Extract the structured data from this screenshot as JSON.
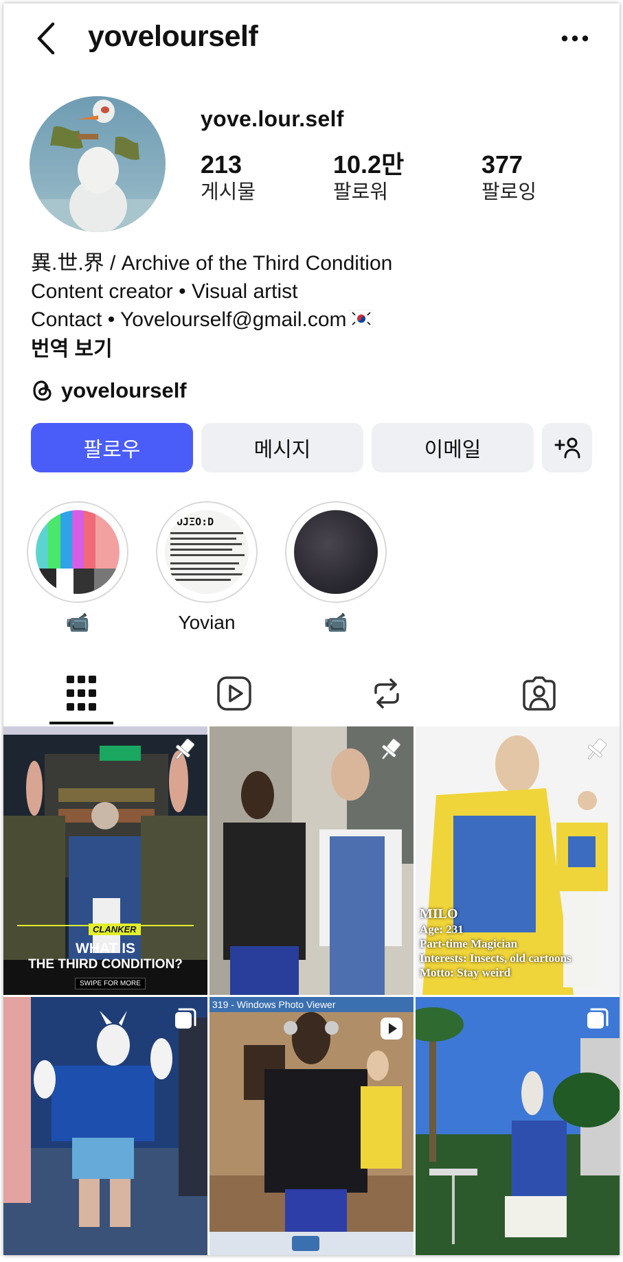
{
  "header": {
    "username": "yovelourself"
  },
  "profile": {
    "display_name": "yove.lour.self",
    "stats": [
      {
        "value": "213",
        "label": "게시물"
      },
      {
        "value": "10.2만",
        "label": "팔로워"
      },
      {
        "value": "377",
        "label": "팔로잉"
      }
    ],
    "bio": [
      "異.世.界 / Archive of the Third Condition",
      "Content creator • Visual artist",
      "Contact • Yovelourself@gmail.com"
    ],
    "translate_label": "번역 보기",
    "threads_handle": "yovelourself"
  },
  "actions": {
    "follow": "팔로우",
    "message": "메시지",
    "email": "이메일",
    "add_user": "+፩"
  },
  "highlights": [
    {
      "label": "📹",
      "icon": "video-camera-emoji"
    },
    {
      "label": "Yovian",
      "icon": ""
    },
    {
      "label": "📹",
      "icon": "video-camera-emoji"
    }
  ],
  "tabs": [
    "grid-icon",
    "reels-icon",
    "reposts-icon",
    "tagged-icon"
  ],
  "posts": [
    {
      "type": "pinned",
      "overlay": [
        "CLANKER",
        "WHAT IS",
        "THE THIRD CONDITION?",
        "SWIPE FOR MORE"
      ]
    },
    {
      "type": "pinned"
    },
    {
      "type": "pinned",
      "overlay": [
        "MILO",
        "Age: 231",
        "Part-time Magician",
        "Interests: Insects, old cartoons",
        "Motto: Stay weird"
      ]
    },
    {
      "type": "carousel"
    },
    {
      "type": "reel",
      "overlay": [
        "319 - Windows Photo Viewer"
      ]
    },
    {
      "type": "carousel"
    }
  ],
  "colors": {
    "accent": "#4a5df9",
    "button_grey": "#eef0f3"
  }
}
